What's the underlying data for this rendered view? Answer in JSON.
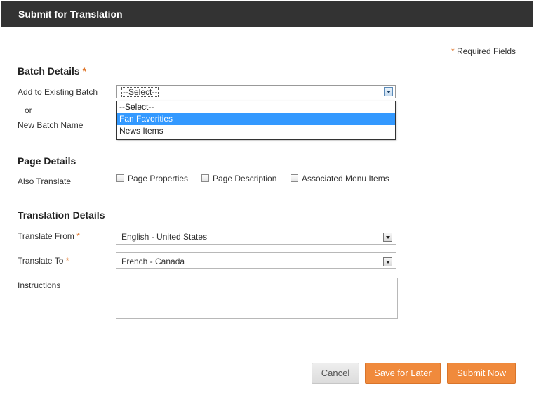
{
  "dialog": {
    "title": "Submit for Translation",
    "required_note": {
      "star": "*",
      "text": "Required Fields"
    }
  },
  "batch": {
    "section_title": "Batch Details",
    "star": "*",
    "existing_label": "Add to Existing Batch",
    "or_label": "or",
    "new_label": "New Batch Name",
    "selected": "--Select--",
    "options": [
      "--Select--",
      "Fan Favorities",
      "News Items"
    ],
    "highlighted_option": "Fan Favorities"
  },
  "page": {
    "section_title": "Page Details",
    "also_translate_label": "Also Translate",
    "checkboxes": [
      {
        "label": "Page Properties",
        "checked": false
      },
      {
        "label": "Page Description",
        "checked": false
      },
      {
        "label": "Associated Menu Items",
        "checked": false
      }
    ]
  },
  "translation": {
    "section_title": "Translation Details",
    "from_label": "Translate From",
    "from_value": "English - United States",
    "to_label": "Translate To",
    "to_value": "French - Canada",
    "star": "*",
    "instructions_label": "Instructions",
    "instructions_value": ""
  },
  "buttons": {
    "cancel": "Cancel",
    "save_later": "Save for Later",
    "submit": "Submit Now"
  },
  "colors": {
    "titlebar": "#333333",
    "accent": "#f08a3c",
    "required_star": "#e0782d",
    "highlight": "#3399ff"
  }
}
